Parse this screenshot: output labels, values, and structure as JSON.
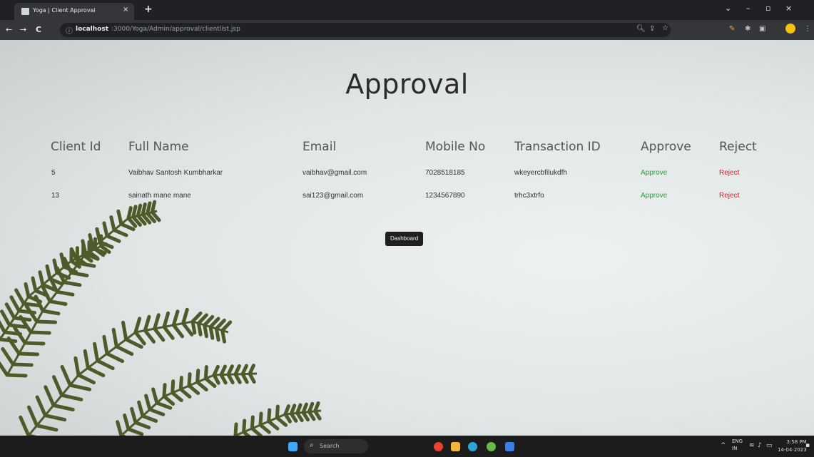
{
  "browser": {
    "tab_title": "Yoga | Client Approval",
    "new_tab": "+",
    "tab_close": "×",
    "nav": {
      "back": "←",
      "forward": "→",
      "reload": "C"
    },
    "url_host": "localhost",
    "url_path": ":3000/Yoga/Admin/approval/clientlist.jsp",
    "window": {
      "minimize": "–",
      "restore": "▫",
      "close": "×",
      "chevron": "⌄"
    }
  },
  "page": {
    "title": "Approval",
    "columns": [
      "Client Id",
      "Full Name",
      "Email",
      "Mobile No",
      "Transaction ID",
      "Approve",
      "Reject"
    ],
    "rows": [
      {
        "id": "5",
        "name": "Vaibhav Santosh Kumbharkar",
        "email": "vaibhav@gmail.com",
        "mobile": "7028518185",
        "txn": "wkeyercbfilukdfh",
        "approve": "Approve",
        "reject": "Reject"
      },
      {
        "id": "13",
        "name": "sainath mane mane",
        "email": "sai123@gmail.com",
        "mobile": "1234567890",
        "txn": "trhc3xtrfo",
        "approve": "Approve",
        "reject": "Reject"
      }
    ],
    "dashboard_button": "Dashboard"
  },
  "taskbar": {
    "search_label": "Search",
    "language": "ENG",
    "region": "IN",
    "time": "3:58 PM",
    "date": "14-04-2023"
  },
  "colors": {
    "approve": "#2e9b3e",
    "reject": "#d21f1f",
    "fern": "#4f5a2a"
  }
}
